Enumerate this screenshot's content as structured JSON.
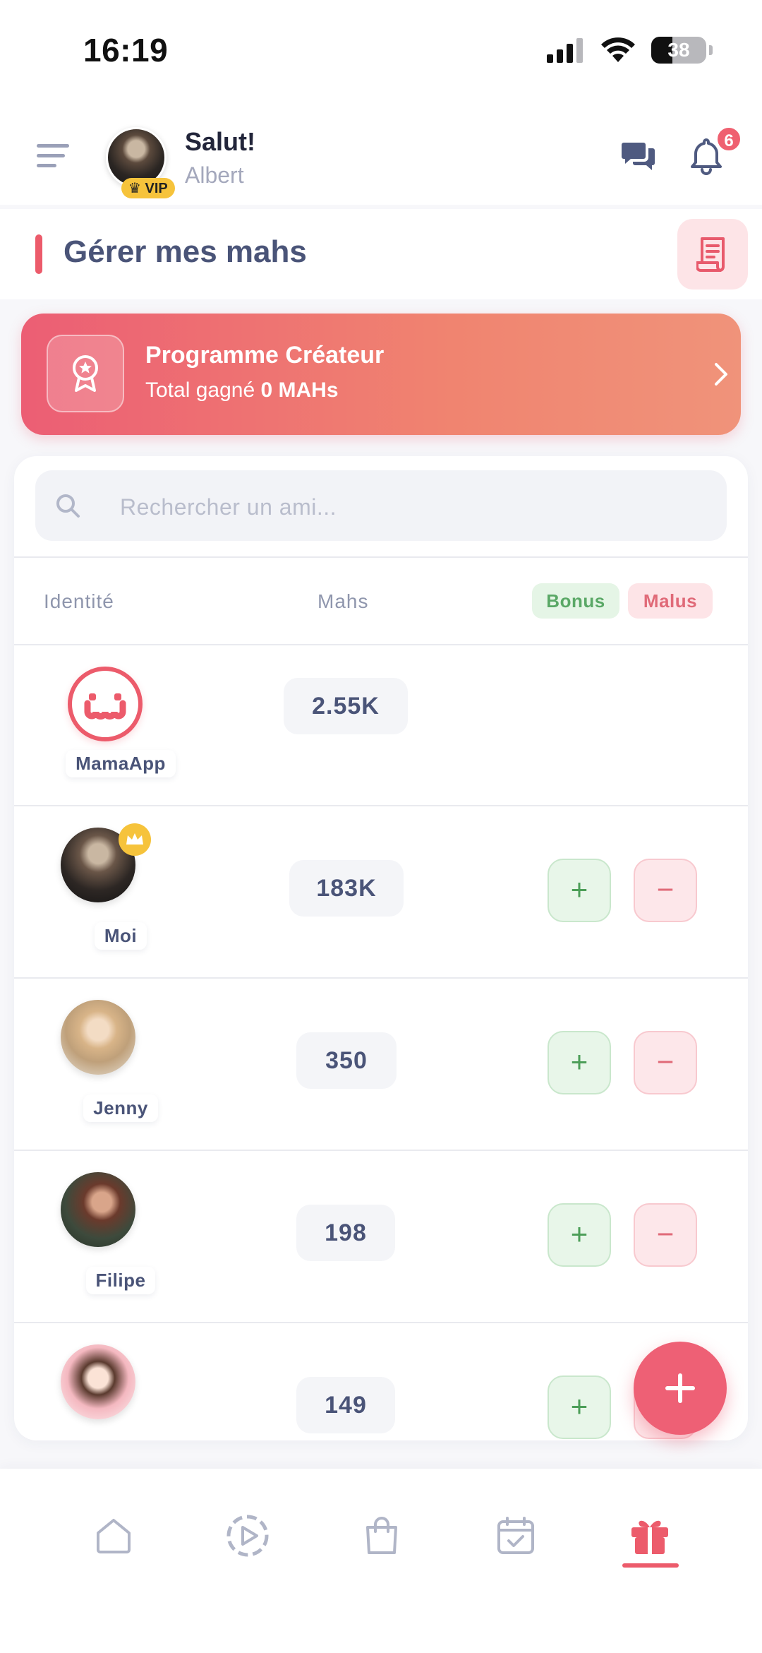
{
  "status_bar": {
    "time": "16:19",
    "battery": "38"
  },
  "header": {
    "greeting": "Salut!",
    "username": "Albert",
    "vip_label": "VIP",
    "notification_count": "6"
  },
  "title_bar": {
    "title": "Gérer mes mahs"
  },
  "creator_program": {
    "title": "Programme Créateur",
    "total_prefix": "Total gagné",
    "total_value": "0 MAHs"
  },
  "search": {
    "placeholder": "Rechercher un ami..."
  },
  "table": {
    "col_identity": "Identité",
    "col_mahs": "Mahs",
    "bonus_label": "Bonus",
    "malus_label": "Malus"
  },
  "rows": [
    {
      "name": "MamaApp",
      "mahs": "2.55K"
    },
    {
      "name": "Moi",
      "mahs": "183K"
    },
    {
      "name": "Jenny",
      "mahs": "350"
    },
    {
      "name": "Filipe",
      "mahs": "198"
    },
    {
      "name": "",
      "mahs": "149"
    }
  ],
  "buttons": {
    "plus": "+",
    "minus": "−"
  },
  "colors": {
    "accent": "#ec5b6b",
    "bonus": "#5aa866",
    "malus": "#e06a78",
    "vip": "#f6c33b"
  },
  "bottom_nav": {
    "items": [
      "home-icon",
      "play-icon",
      "bag-icon",
      "calendar-icon",
      "gift-icon"
    ],
    "active": "gift-icon"
  }
}
